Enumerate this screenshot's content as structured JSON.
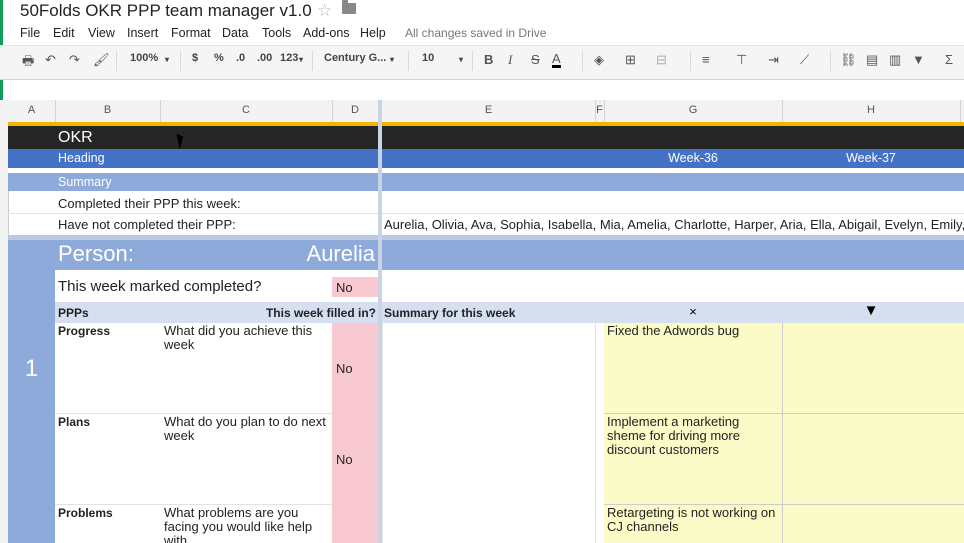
{
  "doc": {
    "title": "50Folds OKR PPP team manager v1.0",
    "saved": "All changes saved in Drive"
  },
  "menu": [
    "File",
    "Edit",
    "View",
    "Insert",
    "Format",
    "Data",
    "Tools",
    "Add-ons",
    "Help"
  ],
  "toolbar": {
    "zoom": "100%",
    "currency": "$",
    "percent": "%",
    "dec_less": ".0",
    "dec_more": ".00",
    "format": "123",
    "font": "Century G...",
    "size": "10"
  },
  "columns": [
    "A",
    "B",
    "C",
    "D",
    "E",
    "F",
    "G",
    "H"
  ],
  "okr": {
    "title": "OKR",
    "heading": "Heading",
    "week36": "Week-36",
    "week37": "Week-37",
    "summary": "Summary"
  },
  "ppp_status": {
    "completed_label": "Completed their PPP this week:",
    "not_completed_label": "Have not completed their PPP:",
    "not_completed_names": "Aurelia, Olivia, Ava, Sophia, Isabella, Mia, Amelia, Charlotte, Harper, Aria, Ella, Abigail, Evelyn, Emily, Av"
  },
  "person": {
    "label": "Person:",
    "name": "Aurelia",
    "marked_question": "This week marked completed?",
    "marked_value": "No",
    "number": "1"
  },
  "ppp_table": {
    "col_ppps": "PPPs",
    "col_filled": "This week filled in?",
    "col_summary": "Summary for this week",
    "x_mark": "×",
    "arrow": "▼"
  },
  "rows": [
    {
      "name": "Progress",
      "question": "What did you achieve this week",
      "filled": "No",
      "entry": "Fixed the Adwords bug"
    },
    {
      "name": "Plans",
      "question": "What do you plan to do next week",
      "filled": "No",
      "entry": "Implement a marketing sheme for driving more discount customers"
    },
    {
      "name": "Problems",
      "question": "What problems are you facing you would like help with",
      "filled": "",
      "entry": "Retargeting is not working on CJ channels"
    }
  ]
}
